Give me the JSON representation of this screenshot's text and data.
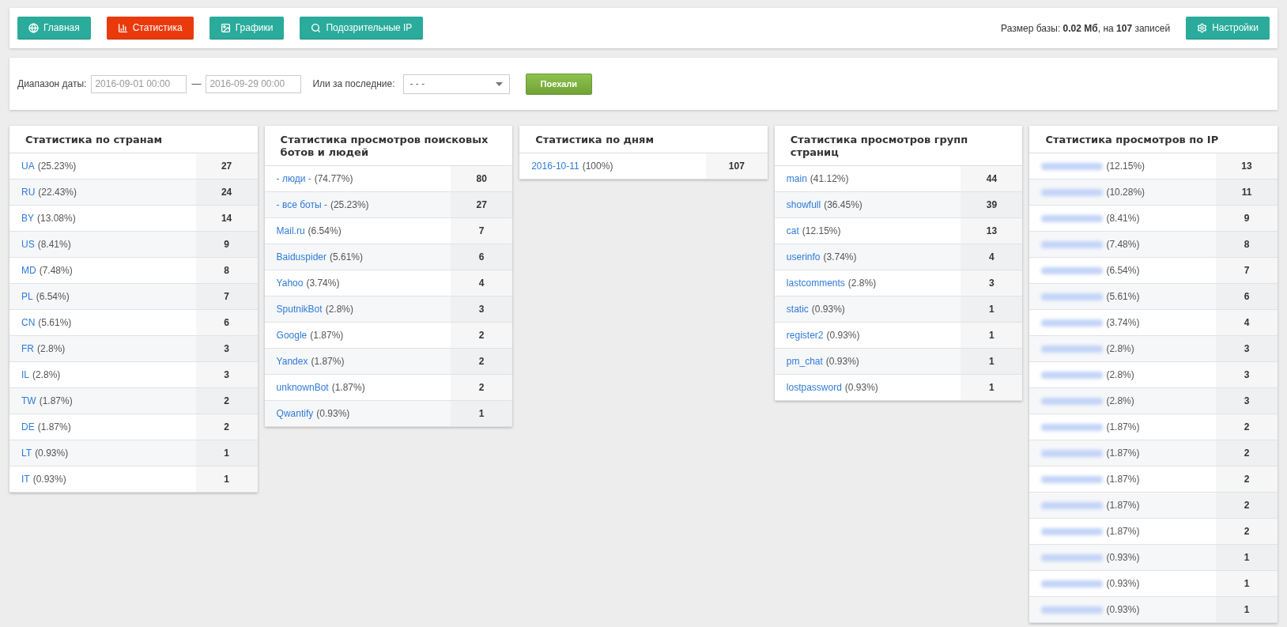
{
  "nav": [
    {
      "label": "Главная",
      "kind": "globe",
      "selected": false
    },
    {
      "label": "Статистика",
      "kind": "chart",
      "selected": true
    },
    {
      "label": "Графики",
      "kind": "image",
      "selected": false
    },
    {
      "label": "Подозрительные IP",
      "kind": "search",
      "selected": false
    }
  ],
  "db_info": "Размер базы: **0.02 Мб**, на **107** записей",
  "settings_button": {
    "label": "Настройки",
    "kind": "gear"
  },
  "filter": {
    "date_label": "Диапазон даты:",
    "date_from": "2016-09-01 00:00",
    "dash": "—",
    "date_to": "2016-09-29 00:00",
    "last_label": "Или за последние:",
    "last_value": "- - -",
    "submit": "Поехали"
  },
  "tables": [
    {
      "title": "Статистика по странам",
      "rows": [
        {
          "kind": "link",
          "label": "UA",
          "percent": "(25.23%)",
          "count": "27"
        },
        {
          "kind": "link",
          "label": "RU",
          "percent": "(22.43%)",
          "count": "24"
        },
        {
          "kind": "link",
          "label": "BY",
          "percent": "(13.08%)",
          "count": "14"
        },
        {
          "kind": "link",
          "label": "US",
          "percent": "(8.41%)",
          "count": "9"
        },
        {
          "kind": "link",
          "label": "MD",
          "percent": "(7.48%)",
          "count": "8"
        },
        {
          "kind": "link",
          "label": "PL",
          "percent": "(6.54%)",
          "count": "7"
        },
        {
          "kind": "link",
          "label": "CN",
          "percent": "(5.61%)",
          "count": "6"
        },
        {
          "kind": "link",
          "label": "FR",
          "percent": "(2.8%)",
          "count": "3"
        },
        {
          "kind": "link",
          "label": "IL",
          "percent": "(2.8%)",
          "count": "3"
        },
        {
          "kind": "link",
          "label": "TW",
          "percent": "(1.87%)",
          "count": "2"
        },
        {
          "kind": "link",
          "label": "DE",
          "percent": "(1.87%)",
          "count": "2"
        },
        {
          "kind": "link",
          "label": "LT",
          "percent": "(0.93%)",
          "count": "1"
        },
        {
          "kind": "link",
          "label": "IT",
          "percent": "(0.93%)",
          "count": "1"
        }
      ]
    },
    {
      "title": "Статистика просмотров поисковых ботов и людей",
      "rows": [
        {
          "kind": "link",
          "label": "- люди -",
          "percent": "(74.77%)",
          "count": "80"
        },
        {
          "kind": "link",
          "label": "- все боты -",
          "percent": "(25.23%)",
          "count": "27"
        },
        {
          "kind": "link",
          "label": "Mail.ru",
          "percent": "(6.54%)",
          "count": "7"
        },
        {
          "kind": "link",
          "label": "Baiduspider",
          "percent": "(5.61%)",
          "count": "6"
        },
        {
          "kind": "link",
          "label": "Yahoo",
          "percent": "(3.74%)",
          "count": "4"
        },
        {
          "kind": "link",
          "label": "SputnikBot",
          "percent": "(2.8%)",
          "count": "3"
        },
        {
          "kind": "link",
          "label": "Google",
          "percent": "(1.87%)",
          "count": "2"
        },
        {
          "kind": "link",
          "label": "Yandex",
          "percent": "(1.87%)",
          "count": "2"
        },
        {
          "kind": "link",
          "label": "unknownBot",
          "percent": "(1.87%)",
          "count": "2"
        },
        {
          "kind": "link",
          "label": "Qwantify",
          "percent": "(0.93%)",
          "count": "1"
        }
      ]
    },
    {
      "title": "Статистика по дням",
      "rows": [
        {
          "kind": "link",
          "label": "2016-10-11",
          "percent": "(100%)",
          "count": "107"
        }
      ]
    },
    {
      "title": "Статистика просмотров групп страниц",
      "rows": [
        {
          "kind": "link",
          "label": "main",
          "percent": "(41.12%)",
          "count": "44"
        },
        {
          "kind": "link",
          "label": "showfull",
          "percent": "(36.45%)",
          "count": "39"
        },
        {
          "kind": "link",
          "label": "cat",
          "percent": "(12.15%)",
          "count": "13"
        },
        {
          "kind": "link",
          "label": "userinfo",
          "percent": "(3.74%)",
          "count": "4"
        },
        {
          "kind": "link",
          "label": "lastcomments",
          "percent": "(2.8%)",
          "count": "3"
        },
        {
          "kind": "link",
          "label": "static",
          "percent": "(0.93%)",
          "count": "1"
        },
        {
          "kind": "link",
          "label": "register2",
          "percent": "(0.93%)",
          "count": "1"
        },
        {
          "kind": "link",
          "label": "pm_chat",
          "percent": "(0.93%)",
          "count": "1"
        },
        {
          "kind": "link",
          "label": "lostpassword",
          "percent": "(0.93%)",
          "count": "1"
        }
      ]
    },
    {
      "title": "Статистика просмотров по IP",
      "rows": [
        {
          "kind": "blurred",
          "percent": "(12.15%)",
          "count": "13"
        },
        {
          "kind": "blurred",
          "percent": "(10.28%)",
          "count": "11"
        },
        {
          "kind": "blurred",
          "percent": "(8.41%)",
          "count": "9"
        },
        {
          "kind": "blurred",
          "percent": "(7.48%)",
          "count": "8"
        },
        {
          "kind": "blurred",
          "percent": "(6.54%)",
          "count": "7"
        },
        {
          "kind": "blurred",
          "percent": "(5.61%)",
          "count": "6"
        },
        {
          "kind": "blurred",
          "percent": "(3.74%)",
          "count": "4"
        },
        {
          "kind": "blurred",
          "percent": "(2.8%)",
          "count": "3"
        },
        {
          "kind": "blurred",
          "percent": "(2.8%)",
          "count": "3"
        },
        {
          "kind": "blurred",
          "percent": "(2.8%)",
          "count": "3"
        },
        {
          "kind": "blurred",
          "percent": "(1.87%)",
          "count": "2"
        },
        {
          "kind": "blurred",
          "percent": "(1.87%)",
          "count": "2"
        },
        {
          "kind": "blurred",
          "percent": "(1.87%)",
          "count": "2"
        },
        {
          "kind": "blurred",
          "percent": "(1.87%)",
          "count": "2"
        },
        {
          "kind": "blurred",
          "percent": "(1.87%)",
          "count": "2"
        },
        {
          "kind": "blurred",
          "percent": "(0.93%)",
          "count": "1"
        },
        {
          "kind": "blurred",
          "percent": "(0.93%)",
          "count": "1"
        },
        {
          "kind": "blurred",
          "percent": "(0.93%)",
          "count": "1"
        }
      ]
    }
  ]
}
